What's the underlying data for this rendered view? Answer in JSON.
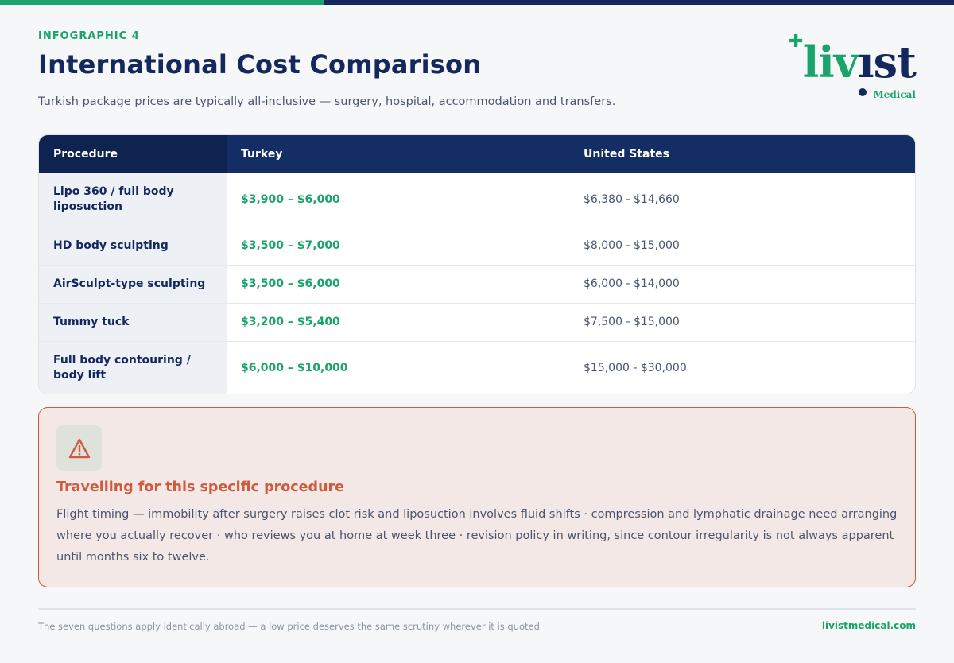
{
  "header": {
    "eyebrow": "INFOGRAPHIC 4",
    "title": "International Cost Comparison",
    "subtitle": "Turkish package prices are typically all-inclusive — surgery, hospital, accommodation and transfers."
  },
  "logo": {
    "word_green": "liv",
    "word_navy": "ıst",
    "subtitle": "Medical"
  },
  "table": {
    "columns": [
      "Procedure",
      "Turkey",
      "United States"
    ],
    "rows": [
      {
        "procedure": "Lipo 360 / full body liposuction",
        "turkey": "$3,900 – $6,000",
        "us": "$6,380 - $14,660"
      },
      {
        "procedure": "HD body sculpting",
        "turkey": "$3,500 – $7,000",
        "us": "$8,000 - $15,000"
      },
      {
        "procedure": "AirSculpt-type sculpting",
        "turkey": "$3,500 – $6,000",
        "us": "$6,000 - $14,000"
      },
      {
        "procedure": "Tummy tuck",
        "turkey": "$3,200 – $5,400",
        "us": "$7,500 - $15,000"
      },
      {
        "procedure": "Full body contouring / body lift",
        "turkey": "$6,000 – $10,000",
        "us": "$15,000 - $30,000"
      }
    ]
  },
  "callout": {
    "icon": "warning-icon",
    "heading": "Travelling for this specific procedure",
    "body": "Flight timing — immobility after surgery raises clot risk and liposuction involves fluid shifts · compression and lymphatic drainage need arranging where you actually recover · who reviews you at home at week three · revision policy in writing, since contour irregularity is not always apparent until months six to twelve."
  },
  "footer": {
    "note": "The seven questions apply identically abroad — a low price deserves the same scrutiny wherever it is quoted",
    "site": "livistmedical.com"
  },
  "colors": {
    "brand_green": "#1aa36a",
    "brand_navy": "#14285e",
    "warning": "#cf5a3c"
  }
}
